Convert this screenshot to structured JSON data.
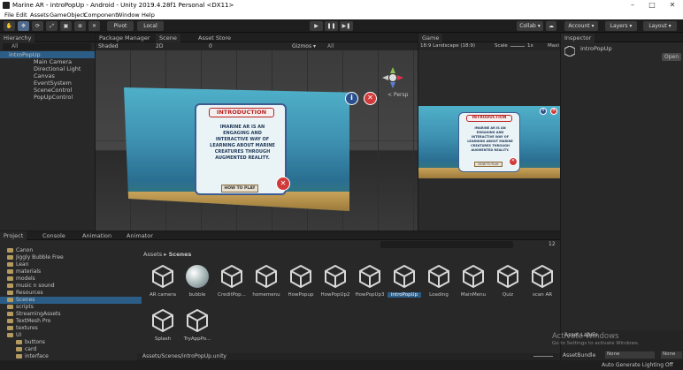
{
  "window": {
    "title": "Marine AR - introPopUp - Android - Unity 2019.4.28f1 Personal <DX11>",
    "min": "–",
    "max": "□",
    "close": "✕"
  },
  "menu": [
    "File",
    "Edit",
    "Assets",
    "GameObject",
    "Component",
    "Window",
    "Help"
  ],
  "toolbar": {
    "pivot": "Pivot",
    "local": "Local",
    "collab": "Collab ▾",
    "account": "Account ▾",
    "layers": "Layers ▾",
    "layout": "Layout ▾"
  },
  "hierarchy": {
    "tab": "Hierarchy",
    "search": "All",
    "root": "introPopUp",
    "items": [
      "Main Camera",
      "Directional Light",
      "Canvas",
      "EventSystem",
      "SceneControl",
      "PopUpControl"
    ]
  },
  "scene": {
    "tabs": [
      "Package Manager",
      "Scene",
      "Asset Store"
    ],
    "shading": "Shaded",
    "mode": "2D",
    "gizmos": "Gizmos ▾",
    "search": "All",
    "persp": "< Persp",
    "fx_count": "0"
  },
  "game": {
    "tab": "Game",
    "aspect": "18:9 Landscape (18:9)",
    "scale_label": "Scale",
    "scale_value": "1x",
    "max": "Maxi"
  },
  "inspector": {
    "tab": "Inspector",
    "object": "introPopUp",
    "open": "Open"
  },
  "popup": {
    "title": "INTRODUCTION",
    "body": "IMARINE AR IS AN ENGAGING AND INTERACTIVE WAY OF LEARNING ABOUT MARINE CREATURES THROUGH AUGMENTED REALITY.",
    "button": "HOW TO PLAY",
    "close": "✕",
    "info": "i"
  },
  "project": {
    "tabs": [
      "Project",
      "Console",
      "Animation",
      "Animator"
    ],
    "breadcrumb": [
      "Assets",
      "Scenes"
    ],
    "count": "12",
    "folders": [
      {
        "name": "Canon",
        "indent": 1
      },
      {
        "name": "Jiggly Bubble Free",
        "indent": 1
      },
      {
        "name": "Lean",
        "indent": 1
      },
      {
        "name": "materials",
        "indent": 1
      },
      {
        "name": "models",
        "indent": 1
      },
      {
        "name": "music n sound",
        "indent": 1
      },
      {
        "name": "Resources",
        "indent": 1
      },
      {
        "name": "Scenes",
        "indent": 1
      },
      {
        "name": "scripts",
        "indent": 1
      },
      {
        "name": "StreamingAssets",
        "indent": 1
      },
      {
        "name": "TextMesh Pro",
        "indent": 1
      },
      {
        "name": "textures",
        "indent": 1
      },
      {
        "name": "UI",
        "indent": 1
      },
      {
        "name": "buttons",
        "indent": 2
      },
      {
        "name": "card",
        "indent": 2
      },
      {
        "name": "interface",
        "indent": 2
      }
    ],
    "assets": [
      "AR camera",
      "bubble",
      "CreditPop...",
      "homemenu",
      "HowPopup",
      "HowPopUp2",
      "HowPopUp3",
      "introPopUp",
      "Loading",
      "MainMenu",
      "Quiz",
      "scan AR",
      "Splash",
      "TryAppPo..."
    ],
    "selected": "introPopUp",
    "path": "Assets/Scenes/introPopUp.unity"
  },
  "inspector_bottom": {
    "labels_title": "Asset Labels",
    "bundle_label": "AssetBundle",
    "bundle_value": "None",
    "variant_value": "None"
  },
  "status": {
    "lighting": "Auto Generate Lighting Off",
    "activate1": "Activate Windows",
    "activate2": "Go to Settings to activate Windows."
  },
  "colors": {
    "accent": "#2c5d87",
    "selected": "#2c5d87",
    "background": "#282828"
  }
}
